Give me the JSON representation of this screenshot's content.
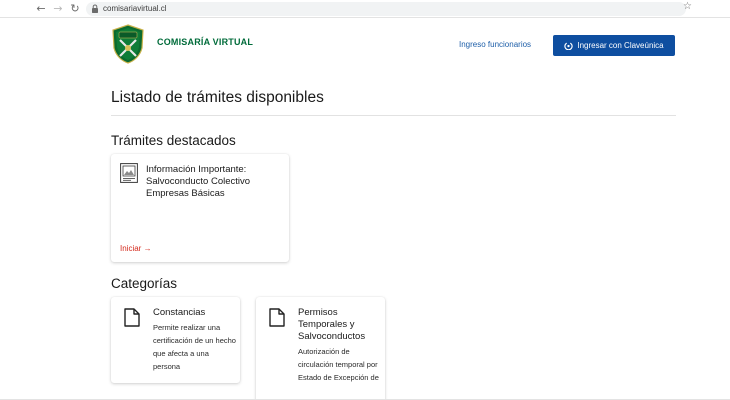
{
  "browser": {
    "url": "comisariavirtual.cl",
    "back_glyph": "←",
    "forward_glyph": "→",
    "reload_glyph": "↻",
    "star_glyph": "☆"
  },
  "header": {
    "brand": "COMISARÍA VIRTUAL",
    "staff_link": "Ingreso funcionarios",
    "login_button": "Ingresar con Claveúnica"
  },
  "main": {
    "page_title": "Listado de trámites disponibles",
    "featured_title": "Trámites destacados",
    "featured_card": {
      "title": "Información Importante: Salvoconducto Colectivo Empresas Básicas",
      "start_link": "Iniciar →"
    },
    "categories_title": "Categorías",
    "categories": [
      {
        "title": "Constancias",
        "description": "Permite realizar una certificación de un hecho que afecta a una persona"
      },
      {
        "title": "Permisos Temporales y Salvoconductos",
        "description": "Autorización de circulación temporal por Estado de Excepción de"
      }
    ]
  },
  "colors": {
    "brand_green": "#006b3a",
    "primary_blue": "#0e4ea0",
    "link_blue": "#1d5ea8",
    "accent_red": "#d52b1e"
  },
  "icons": [
    "lock-icon",
    "star-icon",
    "carabineros-logo",
    "claveunica-icon",
    "document-icon"
  ]
}
